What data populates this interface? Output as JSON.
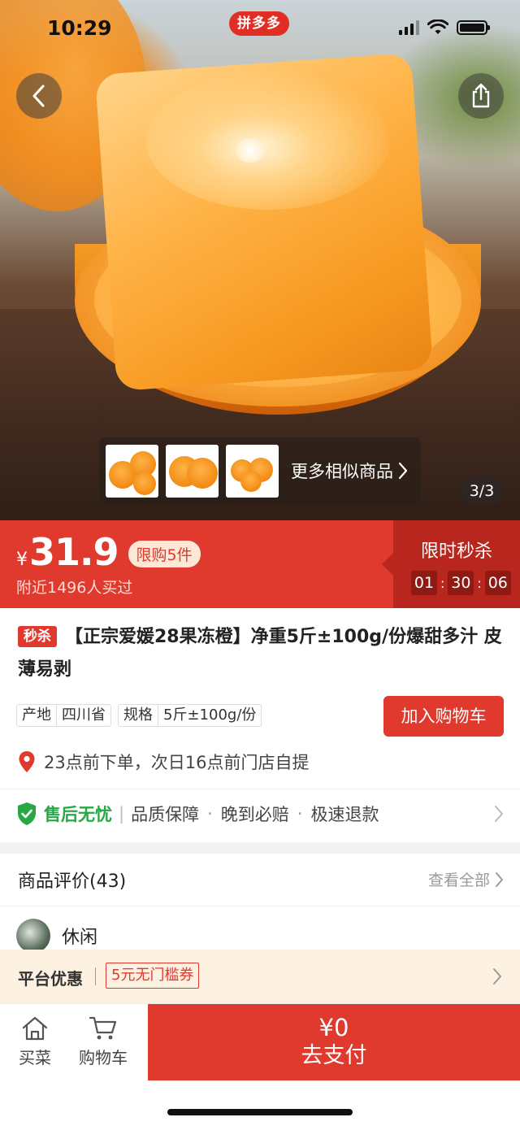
{
  "status_bar": {
    "time": "10:29",
    "brand": "拼多多"
  },
  "gallery": {
    "similar_label": "更多相似商品",
    "counter": "3/3"
  },
  "price": {
    "currency": "¥",
    "amount": "31.9",
    "limit_badge": "限购5件",
    "bought": "附近1496人买过"
  },
  "flash_sale": {
    "title": "限时秒杀",
    "hours": "01",
    "minutes": "30",
    "seconds": "06",
    "separator": ":"
  },
  "product": {
    "tag": "秒杀",
    "title": "【正宗爱媛28果冻橙】净重5斤±100g/份爆甜多汁 皮薄易剥",
    "specs": [
      {
        "key": "产地",
        "value": "四川省"
      },
      {
        "key": "规格",
        "value": "5斤±100g/份"
      }
    ],
    "add_to_cart": "加入购物车",
    "pickup": "23点前下单，次日16点前门店自提"
  },
  "guarantee": {
    "title": "售后无忧",
    "items": [
      "品质保障",
      "晚到必赔",
      "极速退款"
    ],
    "separator": "|",
    "dot": "·"
  },
  "reviews": {
    "header": "商品评价(43)",
    "see_all": "查看全部",
    "first_reviewer": "休闲"
  },
  "promo": {
    "title": "平台优惠",
    "coupon": "5元无门槛券"
  },
  "bottom_bar": {
    "home_label": "买菜",
    "cart_label": "购物车",
    "pay_amount": "¥0",
    "pay_label": "去支付"
  },
  "colors": {
    "accent_red": "#e0392d",
    "flash_panel": "#b9261d",
    "guarantee_green": "#28a745",
    "promo_bg": "#fdf1e2"
  }
}
